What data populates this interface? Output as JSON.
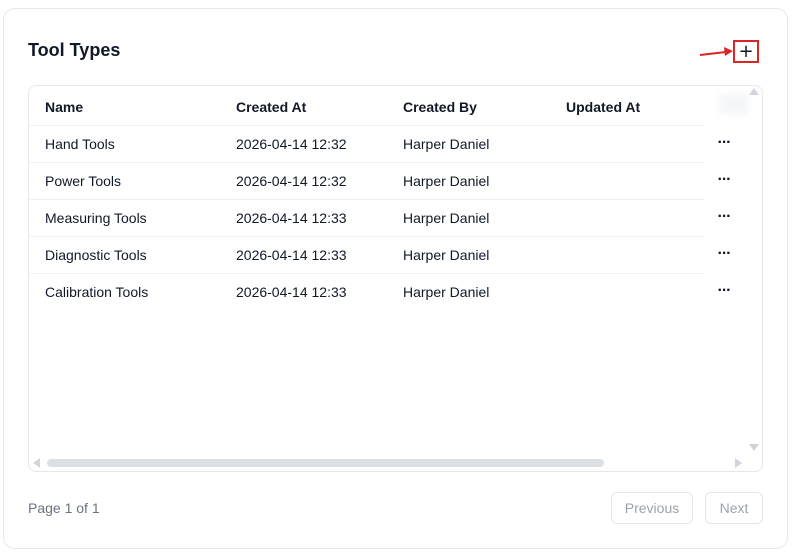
{
  "card": {
    "title": "Tool Types",
    "add_label": "+"
  },
  "table": {
    "columns": [
      "Name",
      "Created At",
      "Created By",
      "Updated At"
    ],
    "more_label": "···",
    "rows": [
      {
        "name": "Hand Tools",
        "created_at": "2026-04-14 12:32",
        "created_by": "Harper Daniel",
        "updated_at": ""
      },
      {
        "name": "Power Tools",
        "created_at": "2026-04-14 12:32",
        "created_by": "Harper Daniel",
        "updated_at": ""
      },
      {
        "name": "Measuring Tools",
        "created_at": "2026-04-14 12:33",
        "created_by": "Harper Daniel",
        "updated_at": ""
      },
      {
        "name": "Diagnostic Tools",
        "created_at": "2026-04-14 12:33",
        "created_by": "Harper Daniel",
        "updated_at": ""
      },
      {
        "name": "Calibration Tools",
        "created_at": "2026-04-14 12:33",
        "created_by": "Harper Daniel",
        "updated_at": ""
      }
    ]
  },
  "pagination": {
    "page_info": "Page 1 of 1",
    "previous_label": "Previous",
    "next_label": "Next"
  },
  "icons": {
    "add": "plus-icon",
    "row_actions": "more-horizontal-icon",
    "annotation": "arrow-right-icon"
  },
  "colors": {
    "highlight": "#dc2626",
    "border": "#e5e7eb",
    "muted_text": "#6b7280"
  }
}
